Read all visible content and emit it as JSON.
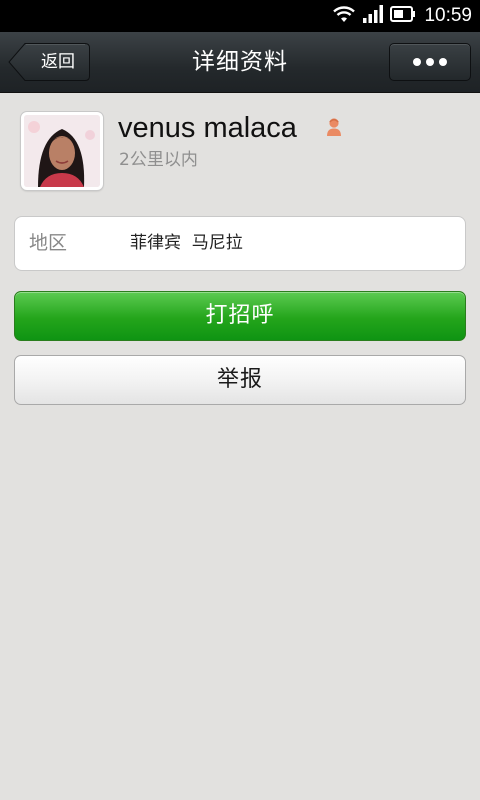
{
  "status_bar": {
    "time": "10:59",
    "icons": [
      "wifi-icon",
      "signal-icon",
      "battery-icon"
    ]
  },
  "header": {
    "back_label": "返回",
    "title": "详细资料",
    "more_icon": "more-dots-icon"
  },
  "profile": {
    "name": "venus malaca",
    "gender_icon": "female-icon",
    "distance": "2公里以内"
  },
  "region": {
    "label": "地区",
    "value": "菲律宾  马尼拉"
  },
  "actions": {
    "greet_label": "打招呼",
    "report_label": "举报"
  },
  "colors": {
    "background": "#e2e1df",
    "title_bar": "#24292c",
    "greet_button": "#1b9e17",
    "gender_icon": "#e8825a"
  }
}
